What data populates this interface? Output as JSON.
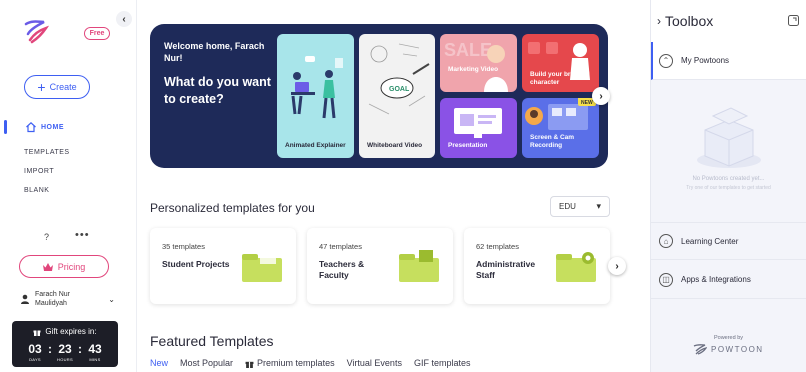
{
  "sidebar": {
    "badge": "Free",
    "create_label": "Create",
    "nav": {
      "home": "HOME",
      "templates": "TEMPLATES",
      "import": "IMPORT",
      "blank": "BLANK"
    },
    "help_glyph": "?",
    "more_glyph": "•••",
    "pricing_label": "Pricing",
    "user": {
      "first": "Farach Nur",
      "last": "Maulidyah"
    },
    "gift": {
      "title": "Gift expires in:",
      "days": "03",
      "hours": "23",
      "mins": "43",
      "days_label": "DAYS",
      "hours_label": "HOURS",
      "mins_label": "MINS"
    },
    "accent": "#3e5ff2",
    "pink": "#e1467c"
  },
  "hero": {
    "welcome": "Welcome home, Farach Nur!",
    "question": "What do you want to create?",
    "cards": [
      {
        "label": "Animated Explainer"
      },
      {
        "label": "Whiteboard Video"
      },
      {
        "label": "Marketing Video"
      },
      {
        "label": "Build your branded character"
      },
      {
        "label": "Presentation"
      },
      {
        "label": "Screen & Cam Recording"
      }
    ],
    "new_badge": "NEW"
  },
  "personalized": {
    "title": "Personalized templates for you",
    "select_value": "EDU",
    "cards": [
      {
        "count": "35 templates",
        "name": "Student Projects"
      },
      {
        "count": "47 templates",
        "name": "Teachers & Faculty"
      },
      {
        "count": "62 templates",
        "name": "Administrative Staff"
      }
    ]
  },
  "featured": {
    "title": "Featured Templates",
    "tabs": [
      "New",
      "Most Popular",
      "Premium templates",
      "Virtual Events",
      "GIF templates"
    ]
  },
  "toolbox": {
    "title": "Toolbox",
    "my_powtoons": "My Powtoons",
    "empty_line1": "No Powtoons created yet...",
    "empty_line2": "Try one of our templates to get started",
    "learning": "Learning Center",
    "apps": "Apps & Integrations",
    "powered_by": "Powered by",
    "brand": "POWTOON"
  }
}
